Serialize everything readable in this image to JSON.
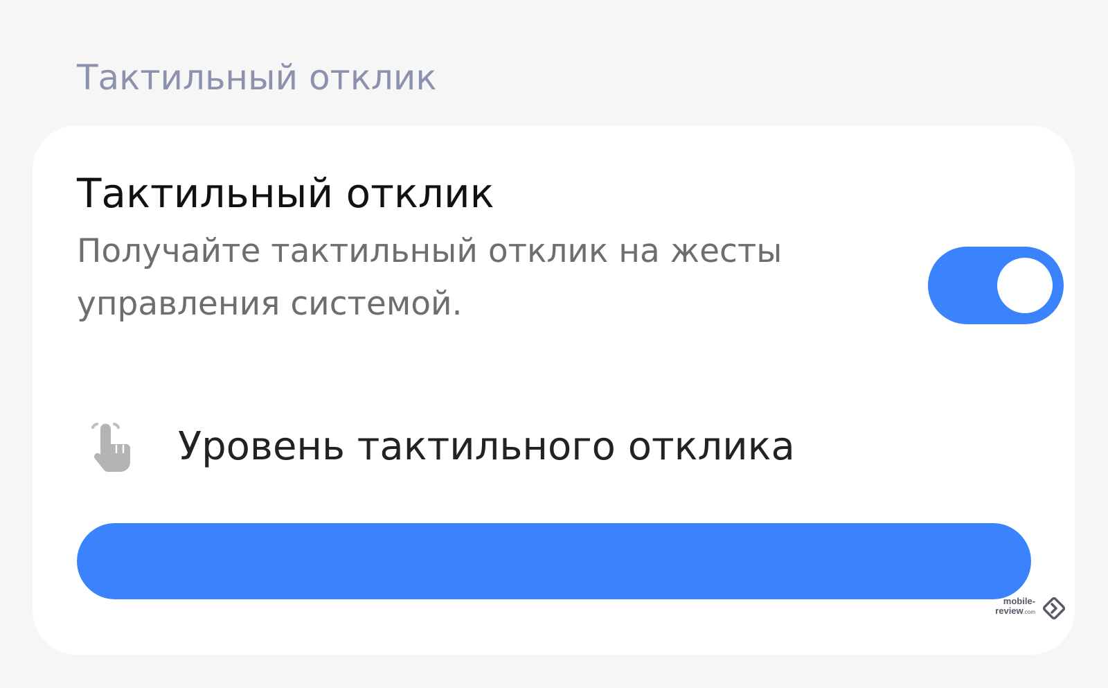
{
  "section": {
    "title": "Тактильный отклик"
  },
  "setting": {
    "title": "Тактильный отклик",
    "description": "Получайте тактильный отклик на жесты управления системой.",
    "toggle_on": true
  },
  "level": {
    "icon": "hand-tap-icon",
    "label": "Уровень тактильного отклика",
    "value_fraction": 1.0
  },
  "watermark": {
    "line1": "mobile-",
    "line2": "review",
    "suffix": ".com"
  },
  "colors": {
    "accent": "#3a83fd",
    "section_header": "#8c92ad",
    "background": "#f6f6f6",
    "card": "#ffffff"
  }
}
